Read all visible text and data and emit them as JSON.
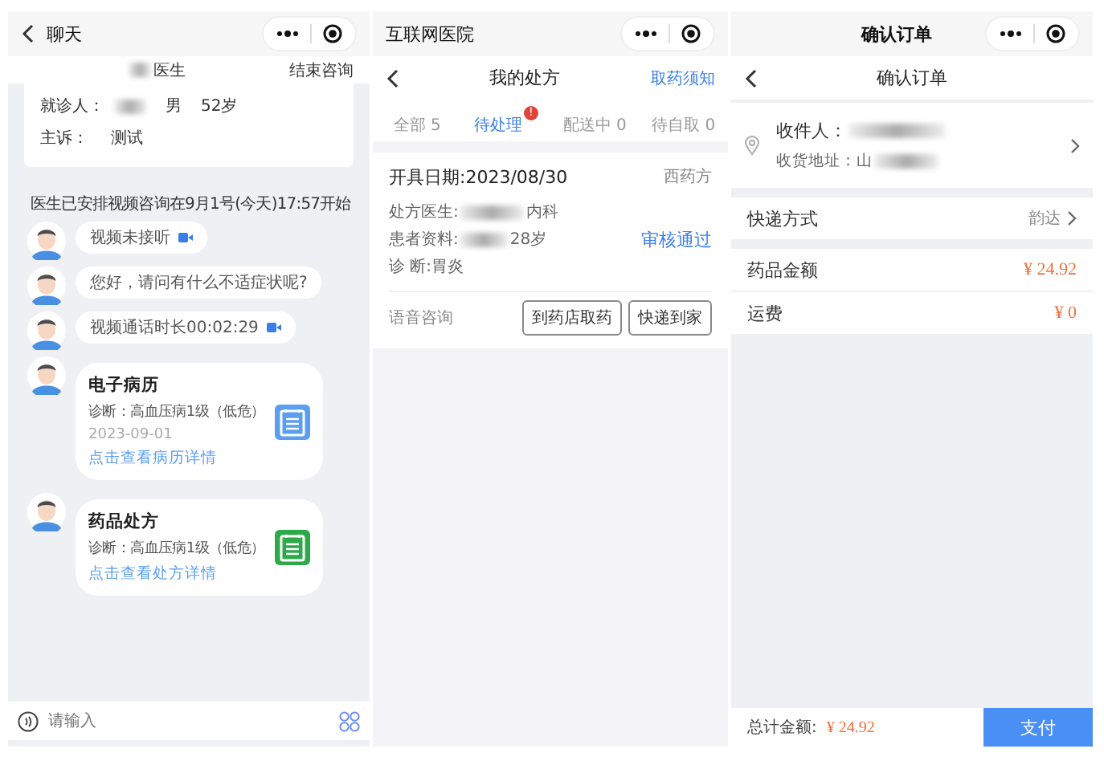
{
  "chat": {
    "title": "聊天",
    "doctor": "医生",
    "end_button": "结束咨询",
    "patient": {
      "label": "就诊人：",
      "gender": "男",
      "age": "52岁"
    },
    "complaint": {
      "label": "主诉：",
      "value": "测试"
    },
    "notice": "医生已安排视频咨询在9月1号(今天)17:57开始",
    "messages": [
      {
        "kind": "video",
        "text": "视频未接听"
      },
      {
        "kind": "text",
        "text": "您好，请问有什么不适症状呢?"
      },
      {
        "kind": "video",
        "text": "视频通话时长00:02:29"
      },
      {
        "kind": "record",
        "title": "电子病历",
        "diagnosis": "诊断：高血压病1级（低危）",
        "date": "2023-09-01",
        "link": "点击查看病历详情",
        "color": "#5b9ef0"
      },
      {
        "kind": "record",
        "title": "药品处方",
        "diagnosis": "诊断：高血压病1级（低危）",
        "link": "点击查看处方详情",
        "color": "#2ea94a"
      }
    ],
    "input": {
      "placeholder": "请输入"
    }
  },
  "prescriptions": {
    "app_title": "互联网医院",
    "title": "我的处方",
    "notice_link": "取药须知",
    "tabs": [
      {
        "label": "全部 5",
        "selected": false
      },
      {
        "label": "待处理",
        "selected": true,
        "badge": "!"
      },
      {
        "label": "配送中 0",
        "selected": false
      },
      {
        "label": "待自取 0",
        "selected": false
      }
    ],
    "card": {
      "date": "开具日期:2023/08/30",
      "type": "西药方",
      "doctor_label": "处方医生:",
      "doctor_dept": "内科",
      "patient_label": "患者资料:",
      "patient_age": "28岁",
      "diagnosis": "诊 断:胃炎",
      "status": "审核通过",
      "consult": "语音咨询",
      "buttons": [
        "到药店取药",
        "快递到家"
      ]
    }
  },
  "order": {
    "app_title": "确认订单",
    "title": "确认订单",
    "recipient_label": "收件人：",
    "address_label": "收货地址：山",
    "shipping": {
      "label": "快递方式",
      "value": "韵达"
    },
    "amounts": [
      {
        "label": "药品金额",
        "value": "¥ 24.92"
      },
      {
        "label": "运费",
        "value": "¥ 0"
      }
    ],
    "total": {
      "label": "总计金额:",
      "value": "¥ 24.92"
    },
    "pay_button": "支付"
  }
}
